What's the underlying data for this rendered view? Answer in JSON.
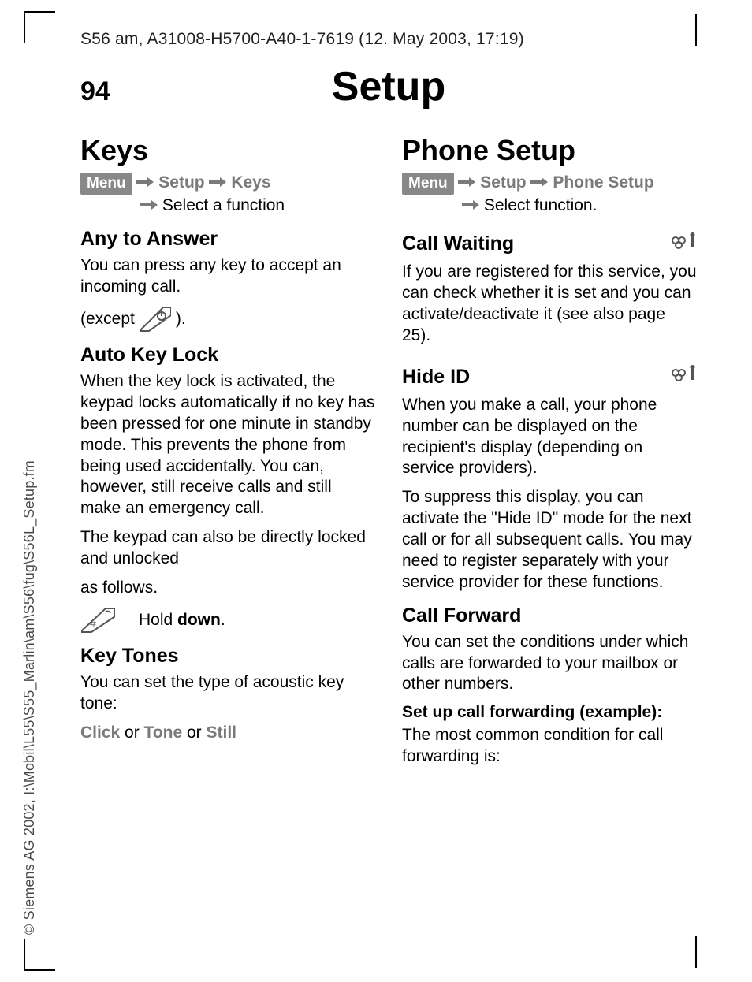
{
  "header_line": "S56 am, A31008-H5700-A40-1-7619 (12. May 2003, 17:19)",
  "vtext": "© Siemens AG 2002, I:\\Mobil\\L55\\S55_Marlin\\am\\S56\\fug\\S56L_Setup.fm",
  "page_number": "94",
  "page_title": "Setup",
  "menu_label": "Menu",
  "left": {
    "h2": "Keys",
    "path": {
      "step1": "Setup",
      "step2": "Keys",
      "select": "Select a function"
    },
    "any_answer": {
      "h3": "Any to Answer",
      "p": "You can press any key to accept an incoming call.",
      "except_before": "(except",
      "except_after": ")."
    },
    "auto_lock": {
      "h3": "Auto Key Lock",
      "p1": "When the key lock is activated, the keypad locks automatically if no key has been pressed for one minute in standby mode. This prevents the phone from being used accidentally. You can, however, still receive calls and still make an emergency call.",
      "p2": "The keypad can also be directly locked and unlocked",
      "p3": "as follows.",
      "hold_prefix": "Hold ",
      "hold_bold": "down",
      "hold_suffix": "."
    },
    "key_tones": {
      "h3": "Key Tones",
      "p": "You can set the type of acoustic key tone:",
      "opt1": "Click",
      "or1": " or ",
      "opt2": "Tone",
      "or2": " or ",
      "opt3": "Still"
    }
  },
  "right": {
    "h2": "Phone Setup",
    "path": {
      "step1": "Setup",
      "step2": "Phone Setup",
      "select": "Select function."
    },
    "call_waiting": {
      "h3": "Call Waiting",
      "p": "If you are registered for this service, you can check whether it is set and you can activate/deactivate it (see also page 25)."
    },
    "hide_id": {
      "h3": "Hide ID",
      "p1": "When you make a call, your phone number can be displayed on the recipient's display (depending on service providers).",
      "p2": "To suppress this display, you can activate the \"Hide ID\" mode for the next call or for all subsequent calls. You may need to register separately with your service provider for these functions."
    },
    "call_forward": {
      "h3": "Call Forward",
      "p1": "You can set the conditions under which calls are forwarded to your mailbox or other numbers.",
      "h4": "Set up call forwarding (example):",
      "p2": "The most common condition for call forwarding is:"
    }
  }
}
